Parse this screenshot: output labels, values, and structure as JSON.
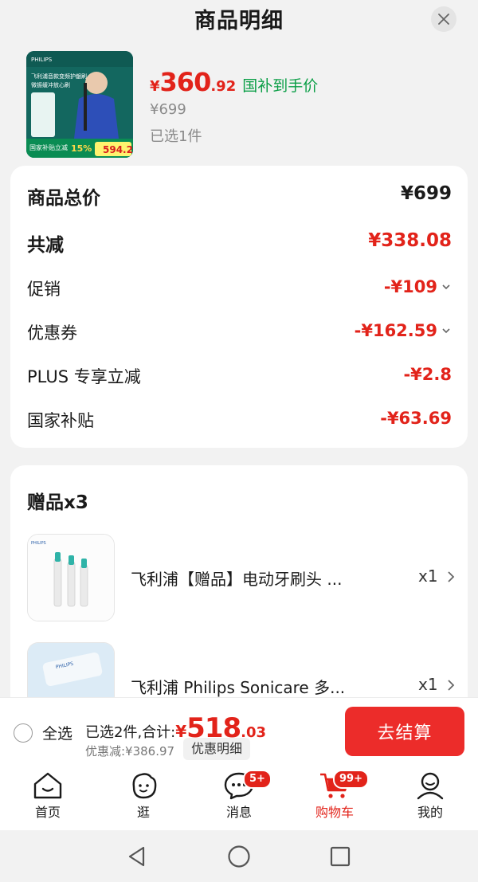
{
  "header": {
    "title": "商品明细"
  },
  "product": {
    "image_texts": [
      "飞利浦音款变频护龈刷",
      "微振缓冲放心刷",
      "国家补贴立减",
      "15%",
      "594.2"
    ],
    "price_symbol": "¥",
    "price_int": "360",
    "price_dec": ".92",
    "subsidy_label": "国补到手价",
    "original_price": "¥699",
    "selected_count": "已选1件"
  },
  "summary": {
    "rows": [
      {
        "label": "商品总价",
        "value": "¥699"
      },
      {
        "label": "共减",
        "value": "¥338.08"
      },
      {
        "label": "促销",
        "value": "-¥109"
      },
      {
        "label": "优惠券",
        "value": "-¥162.59"
      },
      {
        "label": "PLUS 专享立减",
        "value": "-¥2.8"
      },
      {
        "label": "国家补贴",
        "value": "-¥63.69"
      }
    ]
  },
  "gifts": {
    "title": "赠品x3",
    "items": [
      {
        "name": "飞利浦【赠品】电动牙刷头 ...",
        "qty": "x1"
      },
      {
        "name": "飞利浦 Philips  Sonicare  多...",
        "qty": "x1"
      }
    ]
  },
  "checkout": {
    "select_all": "全选",
    "total_prefix": "已选2件,合计:",
    "total_symbol": "¥",
    "total_int": "518",
    "total_dec": ".03",
    "discount_note": "优惠减:¥386.97",
    "detail_label": "优惠明细",
    "pay_label": "去结算"
  },
  "tabbar": {
    "items": [
      {
        "label": "首页"
      },
      {
        "label": "逛"
      },
      {
        "label": "消息",
        "badge": "5+"
      },
      {
        "label": "购物车",
        "badge": "99+"
      },
      {
        "label": "我的"
      }
    ]
  },
  "colors": {
    "accent": "#e2231a",
    "subsidy_green": "#0a9e46",
    "pay_button": "#ec2c2a"
  },
  "icons": [
    "close-icon",
    "chevron-down-icon",
    "chevron-right-icon",
    "home-icon",
    "explore-icon",
    "message-icon",
    "cart-icon",
    "profile-icon",
    "back-icon",
    "home-circle-icon",
    "recents-icon"
  ]
}
